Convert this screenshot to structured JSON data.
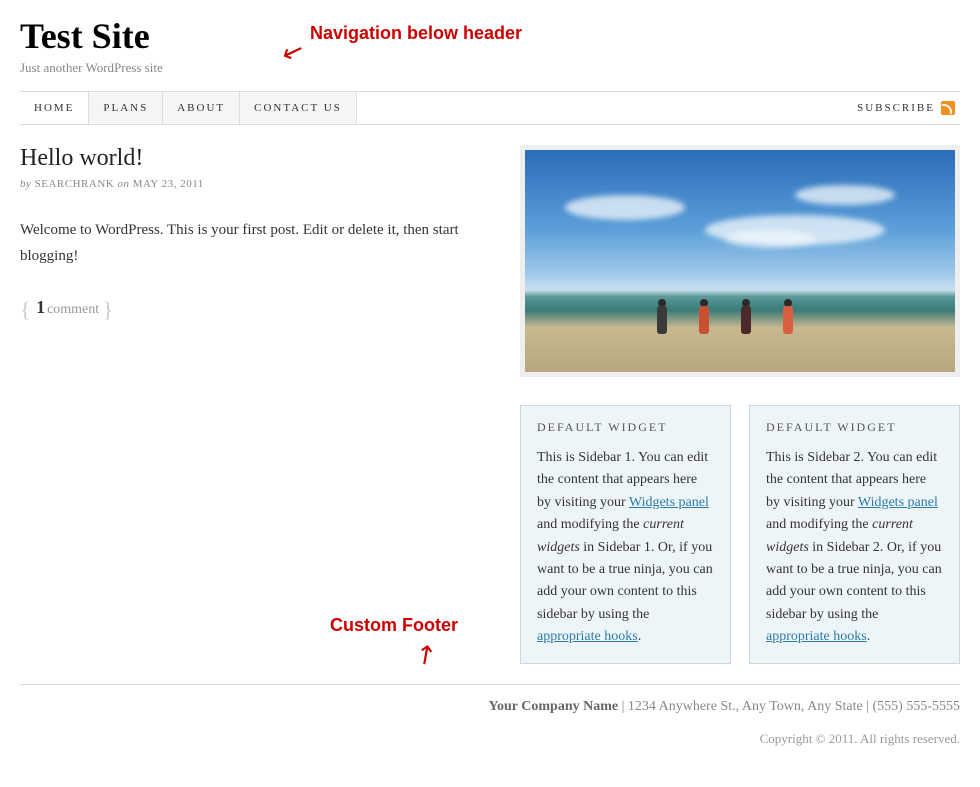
{
  "header": {
    "title": "Test Site",
    "tagline": "Just another WordPress site"
  },
  "annotations": {
    "nav_label": "Navigation below header",
    "footer_label": "Custom Footer"
  },
  "nav": {
    "items": [
      "HOME",
      "PLANS",
      "ABOUT",
      "CONTACT US"
    ],
    "subscribe": "SUBSCRIBE"
  },
  "post": {
    "title": "Hello world!",
    "by": "by",
    "author": "SEARCHRANK",
    "on": "on",
    "date": "MAY 23, 2011",
    "body": "Welcome to WordPress. This is your first post. Edit or delete it, then start blogging!",
    "comment_count": "1",
    "comment_label": "comment"
  },
  "widgets": [
    {
      "title": "Default Widget",
      "text_pre": "This is Sidebar 1. You can edit the content that appears here by visiting your ",
      "link1": "Widgets panel",
      "text_mid1": " and modifying the ",
      "em": "current widgets",
      "text_mid2": " in Sidebar 1. Or, if you want to be a true ninja, you can add your own content to this sidebar by using the ",
      "link2": "appropriate hooks",
      "text_post": "."
    },
    {
      "title": "Default Widget",
      "text_pre": "This is Sidebar 2. You can edit the content that appears here by visiting your ",
      "link1": "Widgets panel",
      "text_mid1": " and modifying the ",
      "em": "current widgets",
      "text_mid2": " in Sidebar 2. Or, if you want to be a true ninja, you can add your own content to this sidebar by using the ",
      "link2": "appropriate hooks",
      "text_post": "."
    }
  ],
  "footer": {
    "company": "Your Company Name",
    "address": " | 1234 Anywhere St., Any Town, Any State | (555) 555-5555",
    "copyright": "Copyright © 2011. All rights reserved."
  }
}
